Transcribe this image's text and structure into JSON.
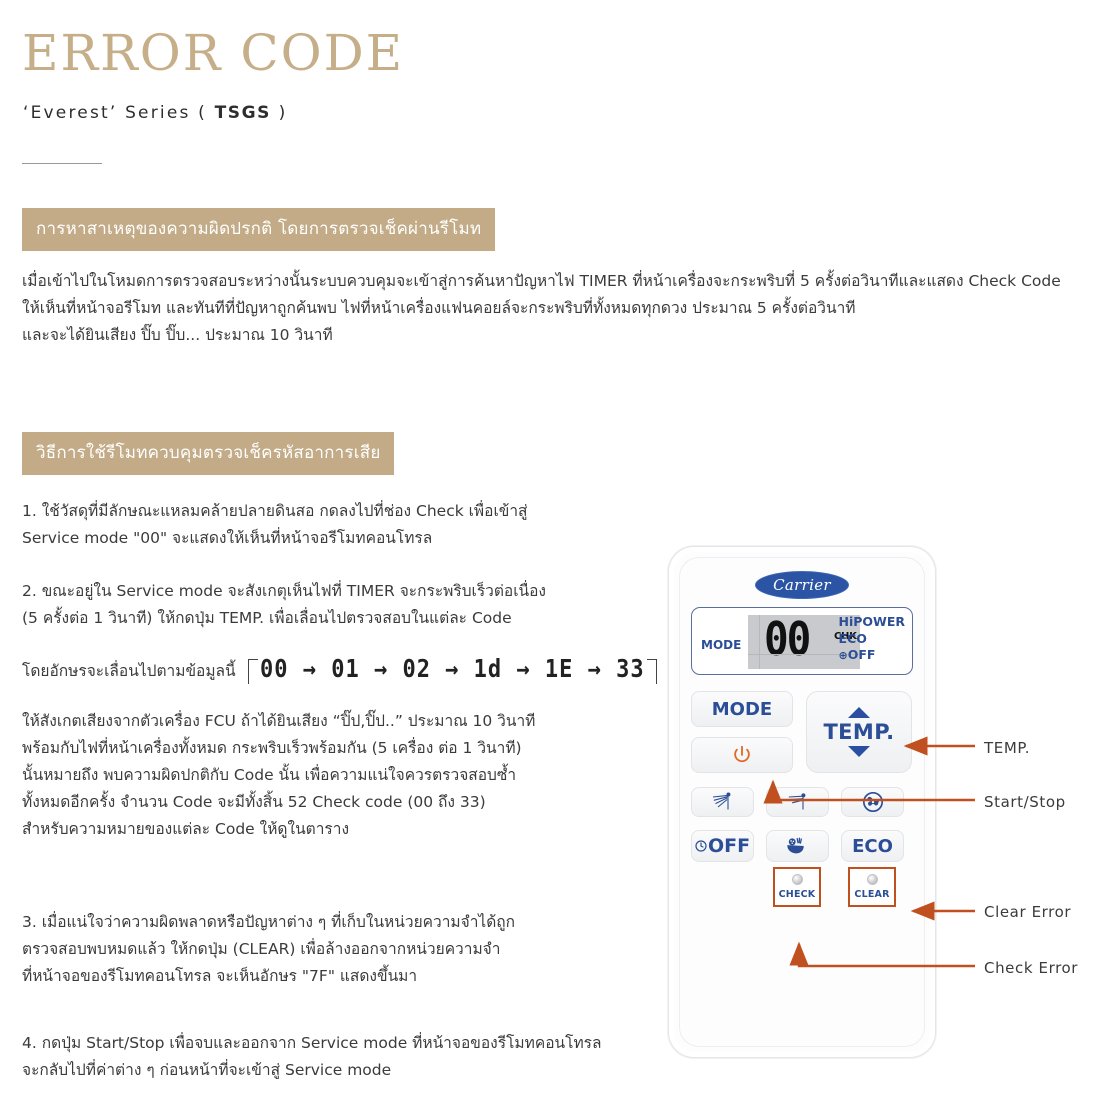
{
  "document": {
    "title": "ERROR CODE",
    "subtitle_prefix": "‘Everest’ Series ( ",
    "subtitle_bold": "TSGS",
    "subtitle_suffix": " )",
    "accent_color": "#c6ae89",
    "band_color": "#c2ab86",
    "annotation_color": "#c0501f",
    "brand_blue": "#2b4e96"
  },
  "sections": [
    {
      "heading": "การหาสาเหตุของความผิดปรกติ โดยการตรวจเช็คผ่านรีโมท",
      "body": "เมื่อเข้าไปในโหมดการตรวจสอบระหว่างนั้นระบบควบคุมจะเข้าสู่การค้นหาปัญหาไฟ TIMER ที่หน้าเครื่องจะกระพริบที่ 5 ครั้งต่อวินาทีและแสดง Check Code\nให้เห็นที่หน้าจอรีโมท และทันทีที่ปัญหาถูกค้นพบ  ไฟที่หน้าเครื่องแฟนคอยล์จะกระพริบที่ทั้งหมดทุกดวง  ประมาณ 5 ครั้งต่อวินาที\nและจะได้ยินเสียง  ปิ๊บ  ปิ๊บ...  ประมาณ 10  วินาที"
    },
    {
      "heading": "วิธีการใช้รีโมทควบคุมตรวจเช็ครหัสอาการเสีย",
      "steps": [
        "1. ใช้วัสดุที่มีลักษณะแหลมคล้ายปลายดินสอ  กดลงไปที่ช่อง Check เพื่อเข้าสู่\nService mode \"00\" จะแสดงให้เห็นที่หน้าจอรีโมทคอนโทรล",
        "2. ขณะอยู่ใน Service mode จะสังเกตุเห็นไฟที่ TIMER จะกระพริบเร็วต่อเนื่อง\n(5 ครั้งต่อ 1 วินาที) ให้กดปุ่ม TEMP. เพื่อเลื่อนไปตรวจสอบในแต่ละ Code",
        "ให้สังเกตเสียงจากตัวเครื่อง FCU ถ้าได้ยินเสียง “ปิ๊ป,ปิ๊ป..” ประมาณ 10 วินาที\nพร้อมกับไฟที่หน้าเครื่องทั้งหมด กระพริบเร็วพร้อมกัน (5 เครื่อง ต่อ 1 วินาที)\nนั้นหมายถึง พบความผิดปกติกับ Code นั้น เพื่อความแน่ใจควรตรวจสอบซ้ำ\nทั้งหมดอีกครั้ง จำนวน Code จะมีทั้งสิ้น 52 Check code (00 ถึง 33)\nสำหรับความหมายของแต่ละ Code ให้ดูในตาราง",
        "3. เมื่อแน่ใจว่าความผิดพลาดหรือปัญหาต่าง ๆ ที่เก็บในหน่วยความจำได้ถูก\nตรวจสอบพบหมดแล้ว ให้กดปุ่ม (CLEAR) เพื่อล้างออกจากหน่วยความจำ\nที่หน้าจอของรีโมทคอนโทรล จะเห็นอักษร \"7F\" แสดงขึ้นมา",
        "4. กดปุ่ม Start/Stop เพื่อจบและออกจาก Service mode ที่หน้าจอของรีโมทคอนโทรล\nจะกลับไปที่ค่าต่าง ๆ ก่อนหน้าที่จะเข้าสู่ Service mode"
      ],
      "sequence_label": "โดยอักษรจะเลื่อนไปตามข้อมูลนี้",
      "sequence": "00 → 01 → 02 → 1d → 1E → 33"
    }
  ],
  "remote": {
    "brand": "Carrier",
    "display": {
      "mode_label": "MODE",
      "digits": "00",
      "chk_label": "CHK",
      "flag_hipower": "HiPOWER",
      "flag_eco": "ECO",
      "flag_off": "OFF",
      "flag_off_icon": "⊕"
    },
    "buttons": {
      "mode": "MODE",
      "power_icon": "power-icon",
      "temp": "TEMP.",
      "temp_up_icon": "caret-up-icon",
      "temp_down_icon": "caret-down-icon",
      "swing_vertical_icon": "airflow-up-icon",
      "swing_horizontal_icon": "airflow-down-icon",
      "fan_icon": "fan-icon",
      "off_timer": "OFF",
      "off_timer_icon": "clock-icon",
      "purify_icon": "air-purify-icon",
      "eco": "ECO",
      "check": "CHECK",
      "clear": "CLEAR"
    }
  },
  "annotations": [
    {
      "label": "TEMP."
    },
    {
      "label": "Start/Stop"
    },
    {
      "label": "Clear  Error"
    },
    {
      "label": "Check  Error"
    }
  ]
}
